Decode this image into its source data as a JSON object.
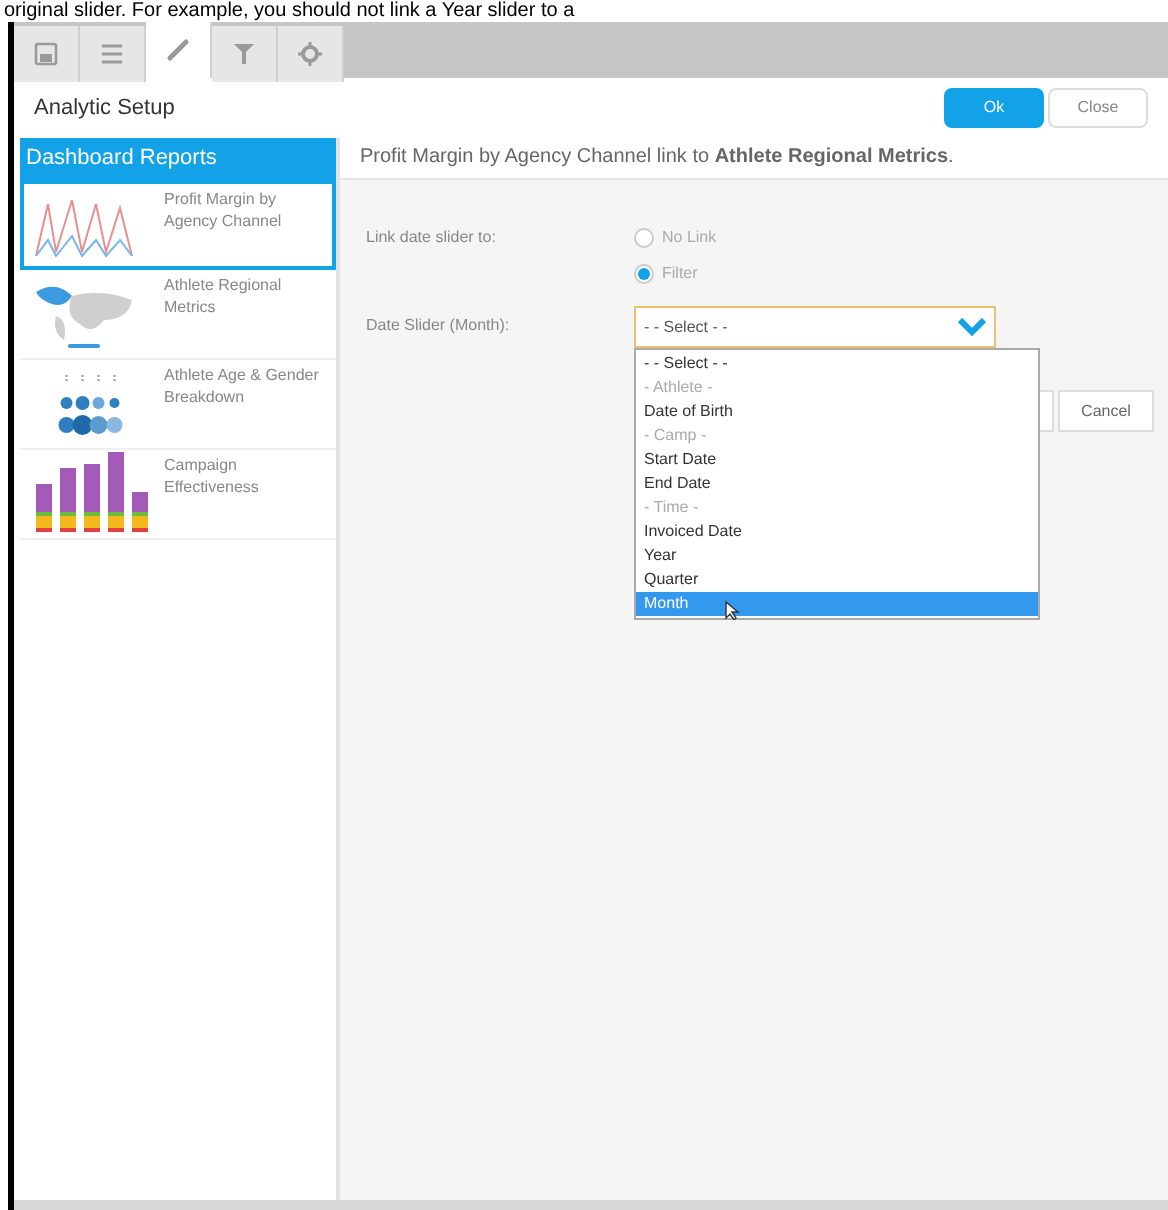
{
  "caption": "original slider. For example, you should not link a Year slider to a",
  "tabs": [
    {
      "kind": "save",
      "selected": false
    },
    {
      "kind": "list",
      "selected": false
    },
    {
      "kind": "link",
      "selected": true
    },
    {
      "kind": "filter",
      "selected": false
    },
    {
      "kind": "settings",
      "selected": false
    }
  ],
  "dialog": {
    "title": "Analytic Setup",
    "buttons": [
      {
        "label": "Ok",
        "primary": true
      },
      {
        "label": "Close",
        "primary": false
      }
    ]
  },
  "sidebar": {
    "title": "Dashboard Reports",
    "items": [
      {
        "label": "Profit Margin by Agency Channel",
        "kind": "line",
        "selected": true
      },
      {
        "label": "Athlete Regional Metrics",
        "kind": "map",
        "selected": false
      },
      {
        "label": "Athlete Age & Gender Breakdown",
        "kind": "bubbles",
        "selected": false
      },
      {
        "label": "Campaign Effectiveness",
        "kind": "bars",
        "selected": false
      }
    ]
  },
  "panel": {
    "heading": "Profit Margin by Agency Channel link to **Athlete Regional Metrics**.",
    "link_label": "Link date slider to:",
    "radios": [
      {
        "label": "No Link",
        "selected": false
      },
      {
        "label": "Filter",
        "selected": true
      }
    ],
    "slider_label": "Date Slider (Month):",
    "select": {
      "value": "- - Select - -",
      "options": [
        {
          "label": "- - Select - -",
          "kind": "option",
          "highlighted": false
        },
        {
          "label": "- Athlete -",
          "kind": "group",
          "highlighted": false
        },
        {
          "label": "Date of Birth",
          "kind": "option",
          "highlighted": false
        },
        {
          "label": "- Camp -",
          "kind": "group",
          "highlighted": false
        },
        {
          "label": "Start Date",
          "kind": "option",
          "highlighted": false
        },
        {
          "label": "End Date",
          "kind": "option",
          "highlighted": false
        },
        {
          "label": "- Time -",
          "kind": "group",
          "highlighted": false
        },
        {
          "label": "Invoiced Date",
          "kind": "option",
          "highlighted": false
        },
        {
          "label": "Year",
          "kind": "option",
          "highlighted": false
        },
        {
          "label": "Quarter",
          "kind": "option",
          "highlighted": false
        },
        {
          "label": "Month",
          "kind": "option",
          "highlighted": true
        }
      ]
    },
    "cancel": "Cancel"
  }
}
